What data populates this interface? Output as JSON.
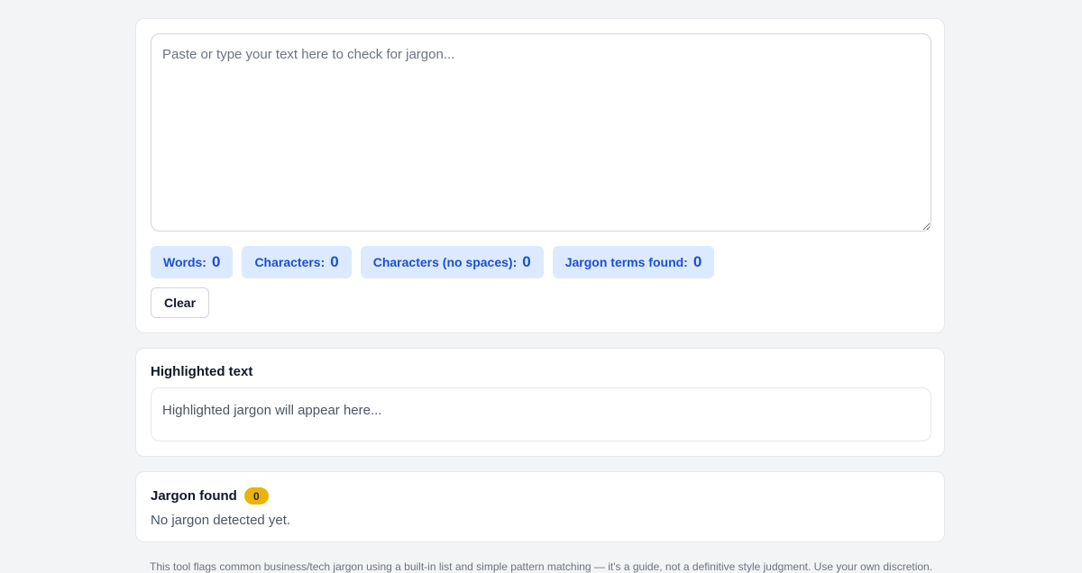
{
  "input": {
    "placeholder": "Paste or type your text here to check for jargon...",
    "value": ""
  },
  "stats": [
    {
      "label": "Words:",
      "value": "0"
    },
    {
      "label": "Characters:",
      "value": "0"
    },
    {
      "label": "Characters (no spaces):",
      "value": "0"
    },
    {
      "label": "Jargon terms found:",
      "value": "0"
    }
  ],
  "actions": {
    "clear_label": "Clear"
  },
  "highlight": {
    "title": "Highlighted text",
    "placeholder": "Highlighted jargon will appear here..."
  },
  "jargon": {
    "title": "Jargon found",
    "count": "0",
    "empty_message": "No jargon detected yet."
  },
  "footer": {
    "note": "This tool flags common business/tech jargon using a built-in list and simple pattern matching — it's a guide, not a definitive style judgment. Use your own discretion."
  },
  "colors": {
    "background": "#f3f4f6",
    "stat_bg": "#dbeafe",
    "stat_text": "#1d4ed8",
    "badge": "#eab308"
  }
}
